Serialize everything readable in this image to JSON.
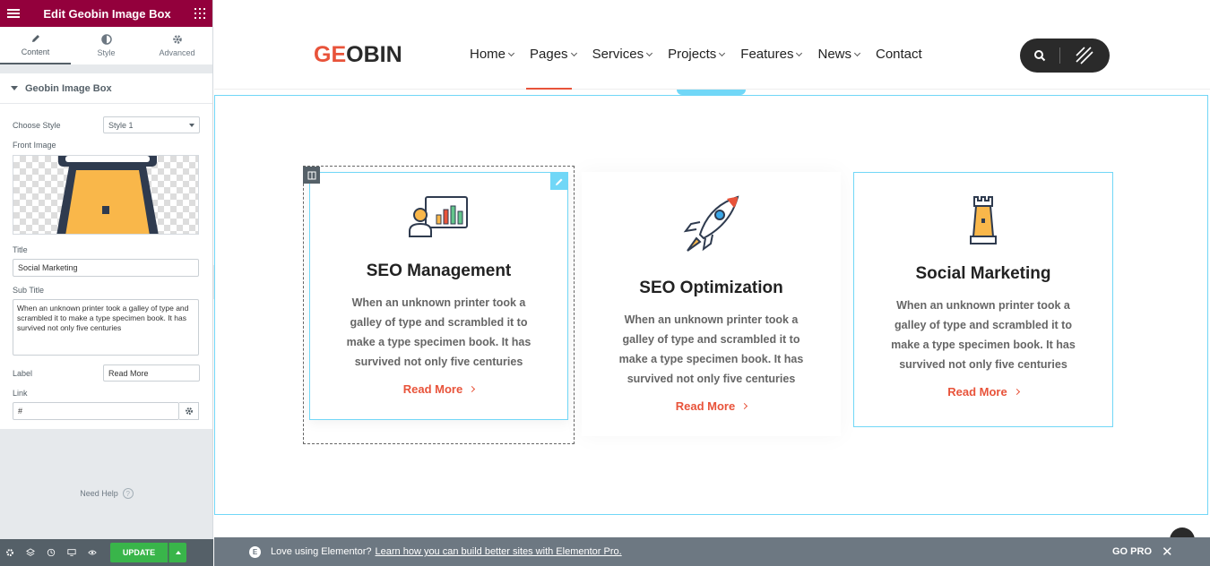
{
  "panel": {
    "header_title": "Edit Geobin Image Box",
    "tabs": [
      {
        "label": "Content",
        "icon": "pencil-icon"
      },
      {
        "label": "Style",
        "icon": "half-circle-icon"
      },
      {
        "label": "Advanced",
        "icon": "gear-icon"
      }
    ],
    "section_title": "Geobin Image Box",
    "choose_style_label": "Choose Style",
    "choose_style_value": "Style 1",
    "front_image_label": "Front Image",
    "title_label": "Title",
    "title_value": "Social Marketing",
    "subtitle_label": "Sub Title",
    "subtitle_value": "When an unknown printer took a galley of type and scrambled it to make a type specimen book. It has survived not only five centuries",
    "label_label": "Label",
    "label_value": "Read More",
    "link_label": "Link",
    "link_value": "#",
    "need_help": "Need Help",
    "update_label": "UPDATE"
  },
  "site": {
    "logo_left": "GE",
    "logo_o": "O",
    "logo_right": "BIN",
    "nav": [
      {
        "label": "Home",
        "has_dropdown": true
      },
      {
        "label": "Pages",
        "has_dropdown": true,
        "active": true
      },
      {
        "label": "Services",
        "has_dropdown": true
      },
      {
        "label": "Projects",
        "has_dropdown": true
      },
      {
        "label": "Features",
        "has_dropdown": true
      },
      {
        "label": "News",
        "has_dropdown": true
      },
      {
        "label": "Contact",
        "has_dropdown": false
      }
    ],
    "accent": "#e8533a"
  },
  "cards": [
    {
      "title": "SEO Management",
      "desc": "When an unknown printer took a galley of type and scrambled it to make a type specimen book. It has survived not only five centuries",
      "link": "Read More",
      "icon": "presentation-chart-icon"
    },
    {
      "title": "SEO Optimization",
      "desc": "When an unknown printer took a galley of type and scrambled it to make a type specimen book. It has survived not only five centuries",
      "link": "Read More",
      "icon": "rocket-icon"
    },
    {
      "title": "Social Marketing",
      "desc": "When an unknown printer took a galley of type and scrambled it to make a type specimen book. It has survived not only five centuries",
      "link": "Read More",
      "icon": "chess-rook-icon"
    }
  ],
  "promo": {
    "text": "Love using Elementor?",
    "link": "Learn how you can build better sites with Elementor Pro.",
    "go_pro": "GO PRO",
    "close": "✕"
  }
}
